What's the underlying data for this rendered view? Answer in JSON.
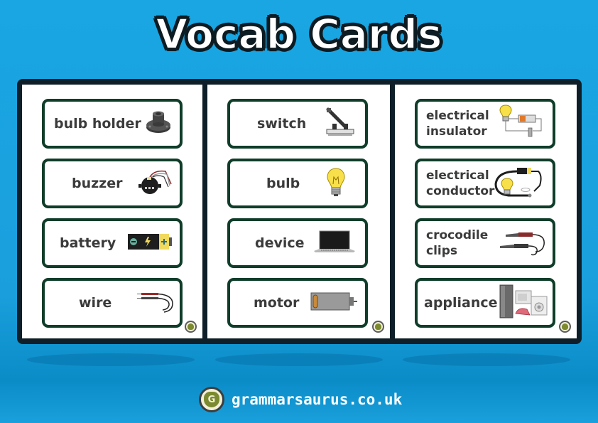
{
  "title": "Vocab Cards",
  "colors": {
    "background": "#19a6e3",
    "board": "#0e1f29",
    "card_border": "#0f3d2a",
    "card_text": "#3b3b3b"
  },
  "columns": [
    {
      "cards": [
        {
          "label": "bulb holder",
          "icon": "bulb-holder-icon"
        },
        {
          "label": "buzzer",
          "icon": "buzzer-icon"
        },
        {
          "label": "battery",
          "icon": "battery-icon"
        },
        {
          "label": "wire",
          "icon": "wire-icon"
        }
      ]
    },
    {
      "cards": [
        {
          "label": "switch",
          "icon": "switch-icon"
        },
        {
          "label": "bulb",
          "icon": "bulb-icon"
        },
        {
          "label": "device",
          "icon": "laptop-icon"
        },
        {
          "label": "motor",
          "icon": "motor-icon"
        }
      ]
    },
    {
      "cards": [
        {
          "label_line1": "electrical",
          "label_line2": "insulator",
          "icon": "insulator-circuit-icon"
        },
        {
          "label_line1": "electrical",
          "label_line2": "conductor",
          "icon": "conductor-circuit-icon"
        },
        {
          "label_line1": "crocodile",
          "label_line2": "clips",
          "icon": "crocodile-clips-icon"
        },
        {
          "label": "appliance",
          "icon": "appliances-icon"
        }
      ]
    }
  ],
  "battery_symbols": {
    "minus": "−",
    "plus": "+",
    "bolt": "⚡"
  },
  "footer": {
    "logo_letter": "G",
    "website": "grammarsaurus.co.uk"
  }
}
